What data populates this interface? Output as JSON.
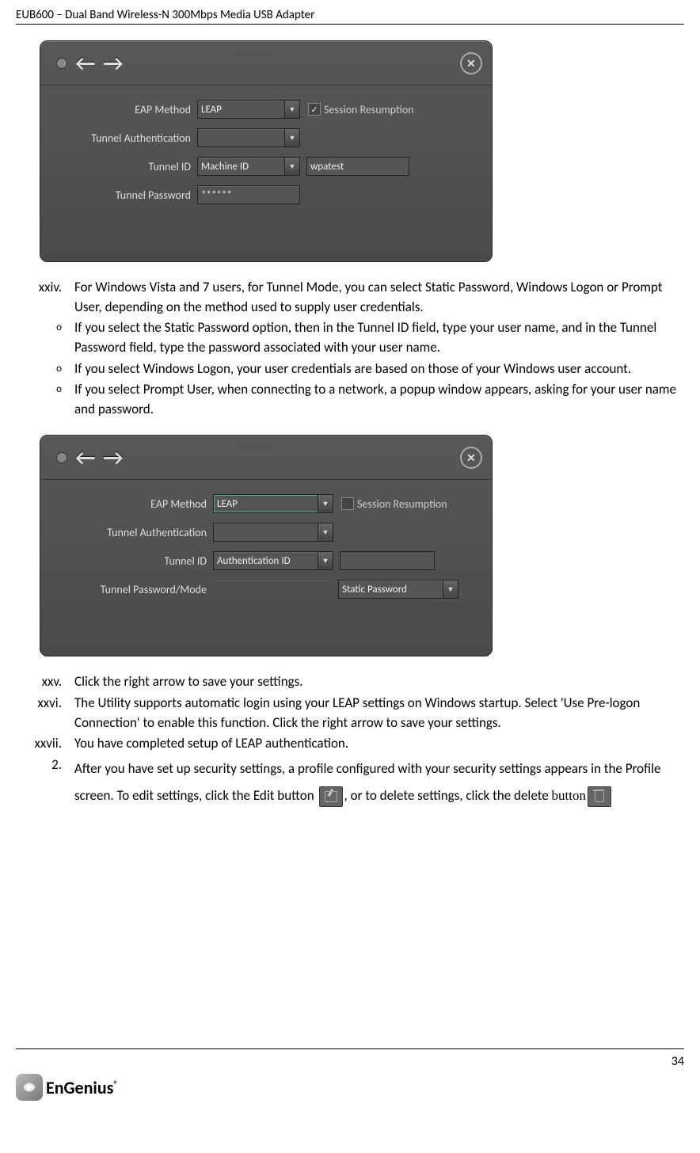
{
  "header": "EUB600 – Dual Band Wireless-N 300Mbps Media USB Adapter",
  "dialog1": {
    "tab": "Profile",
    "eap_label": "EAP Method",
    "eap_value": "LEAP",
    "session_label": "Session Resumption",
    "tunnel_auth_label": "Tunnel Authentication",
    "tunnel_id_label": "Tunnel ID",
    "tunnel_id_value": "Machine ID",
    "tunnel_id_text": "wpatest",
    "tunnel_pw_label": "Tunnel Password",
    "tunnel_pw_value": "******"
  },
  "dialog2": {
    "tab": "Profile",
    "eap_label": "EAP Method",
    "eap_value": "LEAP",
    "session_label": "Session Resumption",
    "tunnel_auth_label": "Tunnel Authentication",
    "tunnel_id_label": "Tunnel ID",
    "tunnel_id_value": "Authentication ID",
    "tunnel_pw_label": "Tunnel Password/Mode",
    "tunnel_pw_mode_value": "Static Password"
  },
  "items": {
    "xxiv": {
      "marker": "xxiv.",
      "text": "For Windows Vista and 7 users, for Tunnel Mode, you can select Static Password, Windows Logon or Prompt User, depending on the method used to supply user credentials."
    },
    "sub1": {
      "marker": "o",
      "text": "If you select the Static Password option, then in the Tunnel ID field, type your user name, and in the Tunnel Password field, type the password associated with your user name."
    },
    "sub2": {
      "marker": "o",
      "text": "If you select Windows Logon, your user credentials are based on those of your Windows user account."
    },
    "sub3": {
      "marker": "o",
      "text": "If you select Prompt User, when connecting to a network, a popup window appears, asking for your user name and password."
    },
    "xxv": {
      "marker": "xxv.",
      "text": "Click the right arrow to save your settings."
    },
    "xxvi": {
      "marker": "xxvi.",
      "text": "The Utility supports automatic login using your LEAP settings on Windows startup. Select 'Use Pre-logon Connection' to enable this function. Click the right arrow to save your settings."
    },
    "xxvii": {
      "marker": "xxvii.",
      "text": "You have completed setup of LEAP authentication."
    },
    "two": {
      "marker": "2.",
      "text_a": "After you have set up security settings, a profile configured with your security settings appears in the Profile screen. To edit settings, click the Edit button ",
      "text_b": ", or to delete settings, click the delete ",
      "text_c": "button"
    }
  },
  "page_number": "34",
  "logo_text": "EnGenius",
  "logo_r": "®"
}
